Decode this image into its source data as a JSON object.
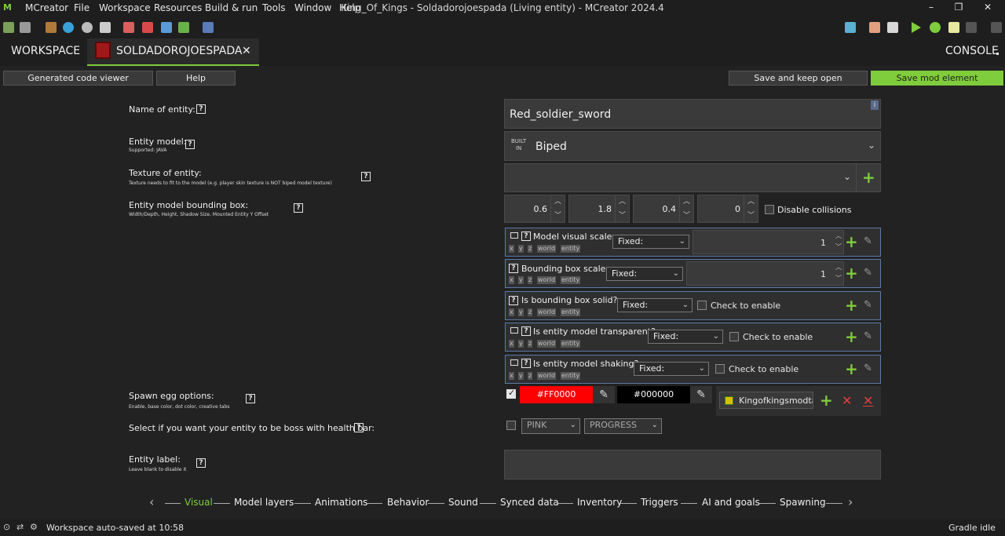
{
  "window": {
    "app_name": "MCreator",
    "menus": [
      "File",
      "Workspace",
      "Resources",
      "Build & run",
      "Tools",
      "Window",
      "Help"
    ],
    "title": "King_Of_Kings - Soldadorojoespada (Living entity) - MCreator 2024.4",
    "minimize": "–",
    "restore": "❐",
    "close": "✕"
  },
  "tabs": {
    "workspace": "WORKSPACE",
    "element": "SOLDADOROJOESPADA",
    "element_close": "✕",
    "console": "CONSOLE"
  },
  "actions": {
    "code_viewer": "Generated code viewer",
    "help": "Help",
    "save_keep_open": "Save and keep open",
    "save_element": "Save mod element"
  },
  "form": {
    "name_label": "Name of entity:",
    "name_value": "Red_soldier_sword",
    "info_badge": "i",
    "model_label": "Entity model:",
    "model_sub": "Supported: JAVA",
    "model_badge_top": "BUILT",
    "model_badge_bottom": "IN",
    "model_value": "Biped",
    "texture_label": "Texture of entity:",
    "texture_sub": "Texture needs to fit to the model (e.g. player skin texture is NOT biped model texture)",
    "bbox_label": "Entity model bounding box:",
    "bbox_sub": "Width/Depth, Height, Shadow Size, Mounted Entity Y Offset",
    "bbox_values": [
      "0.6",
      "1.8",
      "0.4",
      "0"
    ],
    "disable_collisions": "Disable collisions",
    "spawn_label": "Spawn egg options:",
    "spawn_sub": "Enable, base color, dot color, creative tabs",
    "spawn_base_color": "#FF0000",
    "spawn_dot_color": "#000000",
    "creative_tab": "Kingofkingsmodta",
    "boss_label": "Select if you want your entity to be boss with health bar:",
    "boss_color": "PINK",
    "boss_style": "PROGRESS",
    "entity_label_label": "Entity label:",
    "entity_label_sub": "Leave blank to disable it",
    "help_mark": "?"
  },
  "properties": [
    {
      "title": "Model visual scale:",
      "mode": "Fixed:",
      "value": "1"
    },
    {
      "title": "Bounding box scale:",
      "mode": "Fixed:",
      "value": "1"
    },
    {
      "title": "Is bounding box solid?",
      "mode": "Fixed:",
      "check": "Check to enable"
    },
    {
      "title": "Is entity model transparent?",
      "mode": "Fixed:",
      "check": "Check to enable"
    },
    {
      "title": "Is entity model shaking?",
      "mode": "Fixed:",
      "check": "Check to enable"
    }
  ],
  "deps": [
    "x",
    "y",
    "z",
    "world",
    "entity"
  ],
  "nav": [
    "Visual",
    "Model layers",
    "Animations",
    "Behavior",
    "Sound",
    "Synced data",
    "Inventory",
    "Triggers",
    "AI and goals",
    "Spawning"
  ],
  "status": {
    "left": "Workspace auto-saved at 10:58",
    "right": "Gradle idle"
  },
  "colors": {
    "accent": "#7fcc3c",
    "background": "#222222",
    "red": "#ff0000",
    "black": "#000000"
  }
}
